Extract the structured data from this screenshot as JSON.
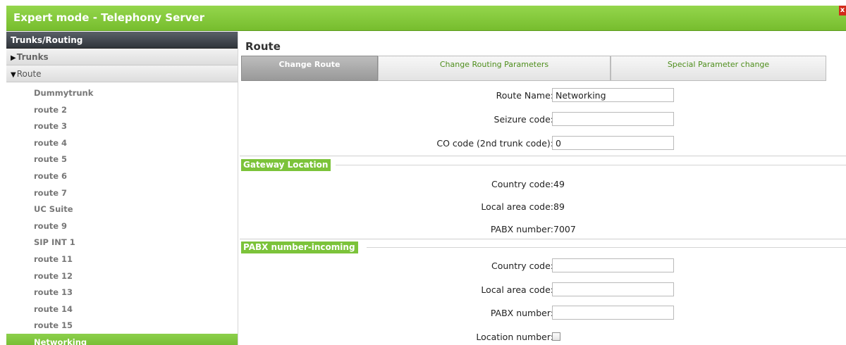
{
  "window": {
    "title": "Expert mode - Telephony Server",
    "close_glyph": "x"
  },
  "sidebar": {
    "header": "Trunks/Routing",
    "groups": {
      "trunks": "Trunks",
      "route": "Route"
    },
    "items": [
      "Dummytrunk",
      "route 2",
      "route 3",
      "route 4",
      "route 5",
      "route 6",
      "route 7",
      "UC Suite",
      "route 9",
      "SIP INT 1",
      "route 11",
      "route 12",
      "route 13",
      "route 14",
      "route 15",
      "Networking"
    ],
    "active_item": "Networking"
  },
  "main": {
    "title": "Route",
    "tabs": [
      {
        "label": "Change Route",
        "active": true
      },
      {
        "label": "Change Routing Parameters",
        "active": false
      },
      {
        "label": "Special Parameter change",
        "active": false
      }
    ],
    "route_name_label": "Route Name:",
    "route_name_value": "Networking",
    "seizure_code_label": "Seizure code:",
    "seizure_code_value": "",
    "co_code_label": "CO code (2nd trunk code):",
    "co_code_value": "0",
    "gateway_location": {
      "title": "Gateway Location",
      "country_code_label": "Country code:",
      "country_code_value": "49",
      "local_area_code_label": "Local area code:",
      "local_area_code_value": "89",
      "pabx_number_label": "PABX number:",
      "pabx_number_value": "7007"
    },
    "pabx_incoming": {
      "title": "PABX number-incoming",
      "country_code_label": "Country code:",
      "country_code_value": "",
      "local_area_code_label": "Local area code:",
      "local_area_code_value": "",
      "pabx_number_label": "PABX number:",
      "pabx_number_value": "",
      "location_number_label": "Location number:",
      "location_number_checked": false
    }
  },
  "colors": {
    "brand_green": "#7cc33a",
    "tab_text_green": "#4e8e1c",
    "active_tab_gray": "#999999",
    "close_red": "#d22b1a"
  },
  "icons": {
    "collapsed": "triangle-right-icon",
    "expanded": "triangle-down-icon",
    "close": "close-icon"
  }
}
